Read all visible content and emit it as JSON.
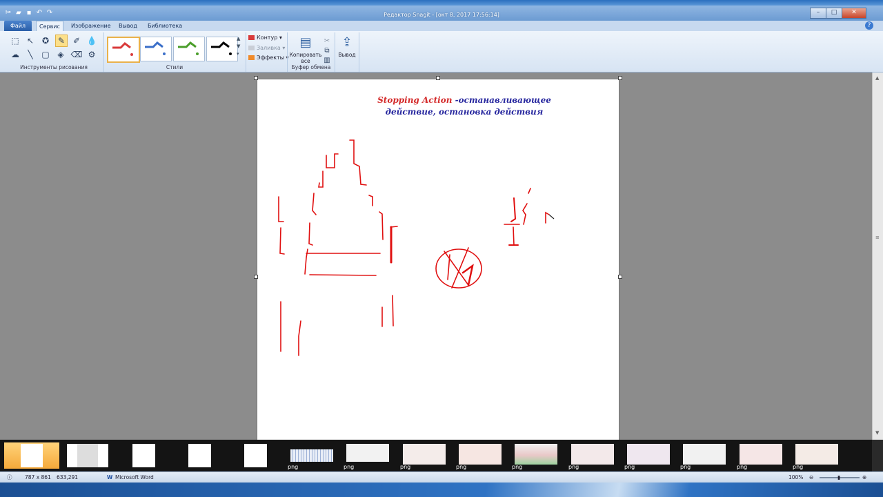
{
  "window": {
    "title": "Редактор Snagit - [окт 8, 2017 17:56:14]",
    "controls": {
      "minimize": "–",
      "maximize": "□",
      "close": "✕"
    }
  },
  "quick_access": [
    "snagit-logo-icon",
    "open-icon",
    "save-icon",
    "undo-icon",
    "redo-icon"
  ],
  "tabs": [
    {
      "label": "Файл"
    },
    {
      "label": "Сервис"
    },
    {
      "label": "Изображение"
    },
    {
      "label": "Вывод"
    },
    {
      "label": "Библиотека"
    }
  ],
  "ribbon": {
    "tools_group_label": "Инструменты рисования",
    "styles_group_label": "Стили",
    "style_colors": [
      "#d93a3a",
      "#3b6fc9",
      "#4a9e2a",
      "#000000"
    ],
    "outline_label": "Контур",
    "fill_label": "Заливка",
    "effects_label": "Эффекты",
    "copy_all_label": "Копировать все",
    "clipboard_group_label": "Буфер обмена",
    "output_label": "Вывод"
  },
  "canvas": {
    "title_en": "Stopping Action",
    "title_ru_1": " -останавливающее",
    "title_ru_2": "действие, остановка действия",
    "stroke_color": "#e01010"
  },
  "tray": {
    "thumb_label": "png"
  },
  "status": {
    "image_size": "787 x 861",
    "cursor": "633,291",
    "app": "Microsoft Word",
    "zoom": "100%"
  }
}
